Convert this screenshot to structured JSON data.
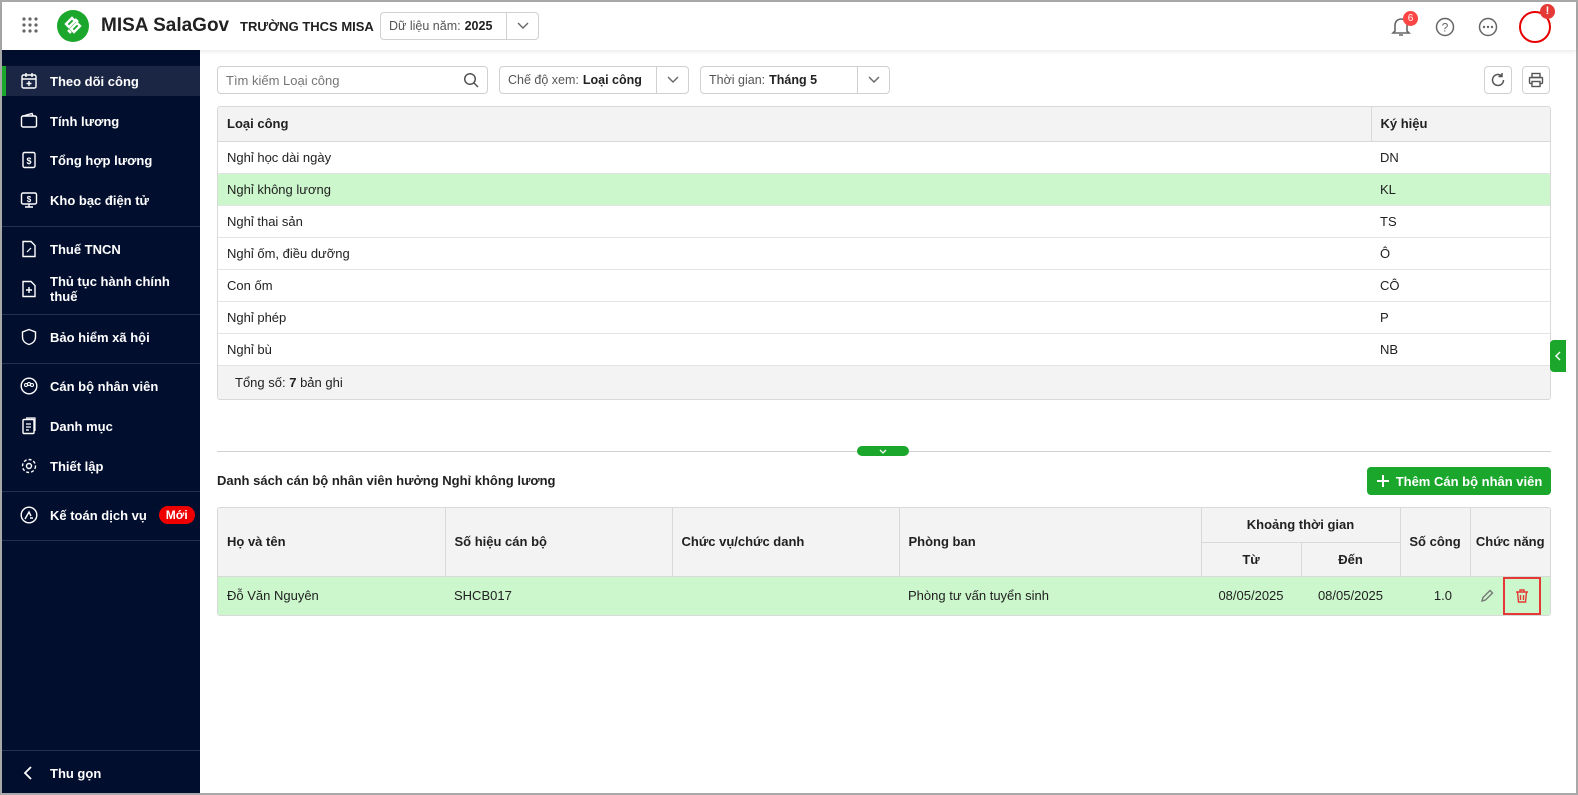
{
  "header": {
    "app_name": "MISA SalaGov",
    "school": "TRƯỜNG THCS MISA",
    "year_label": "Dữ liệu năm:",
    "year_value": "2025",
    "notification_count": "6",
    "avatar_alert": "!"
  },
  "sidebar": {
    "items": [
      {
        "label": "Theo dõi công",
        "icon": "calendar-icon",
        "active": true
      },
      {
        "label": "Tính lương",
        "icon": "wallet-icon"
      },
      {
        "label": "Tổng hợp lương",
        "icon": "salary-doc-icon"
      },
      {
        "label": "Kho bạc điện tử",
        "icon": "monitor-money-icon"
      },
      {
        "label": "Thuế TNCN",
        "icon": "tax-doc-icon"
      },
      {
        "label": "Thủ tục hành chính thuế",
        "icon": "doc-plus-icon"
      },
      {
        "label": "Bảo hiểm xã hội",
        "icon": "shield-heart-icon"
      },
      {
        "label": "Cán bộ nhân viên",
        "icon": "people-icon"
      },
      {
        "label": "Danh mục",
        "icon": "list-icon"
      },
      {
        "label": "Thiết lập",
        "icon": "gear-icon"
      },
      {
        "label": "Kế toán dịch vụ",
        "icon": "accounting-icon",
        "badge": "Mới"
      }
    ],
    "collapse_label": "Thu gọn"
  },
  "toolbar": {
    "search_placeholder": "Tìm kiếm Loại công",
    "view_label": "Chế độ xem:",
    "view_value": "Loại công",
    "time_label": "Thời gian:",
    "time_value": "Tháng 5"
  },
  "type_table": {
    "columns": [
      "Loại công",
      "Ký hiệu"
    ],
    "rows": [
      [
        "Nghỉ học dài ngày",
        "DN"
      ],
      [
        "Nghỉ không lương",
        "KL"
      ],
      [
        "Nghỉ thai sản",
        "TS"
      ],
      [
        "Nghỉ ốm, điều dưỡng",
        "Ô"
      ],
      [
        "Con ốm",
        "CÔ"
      ],
      [
        "Nghỉ phép",
        "P"
      ],
      [
        "Nghỉ bù",
        "NB"
      ]
    ],
    "selected_row": 1,
    "footer_prefix": "Tổng số:",
    "footer_count": "7",
    "footer_suffix": "bản ghi"
  },
  "staff": {
    "title": "Danh sách cán bộ nhân viên hưởng Nghỉ không lương",
    "add_button": "Thêm Cán bộ nhân viên",
    "columns": {
      "name": "Họ và tên",
      "code": "Số hiệu cán bộ",
      "position": "Chức vụ/chức danh",
      "department": "Phòng ban",
      "period": "Khoảng thời gian",
      "from": "Từ",
      "to": "Đến",
      "days": "Số công",
      "actions": "Chức năng"
    },
    "rows": [
      {
        "name": "Đỗ Văn Nguyên",
        "code": "SHCB017",
        "position": "",
        "department": "Phòng tư vấn tuyển sinh",
        "from": "08/05/2025",
        "to": "08/05/2025",
        "days": "1.0"
      }
    ]
  },
  "colors": {
    "accent": "#1aa72c",
    "sidebar": "#020e2e",
    "selected_row": "#ccf7cc",
    "danger": "#e53935"
  }
}
